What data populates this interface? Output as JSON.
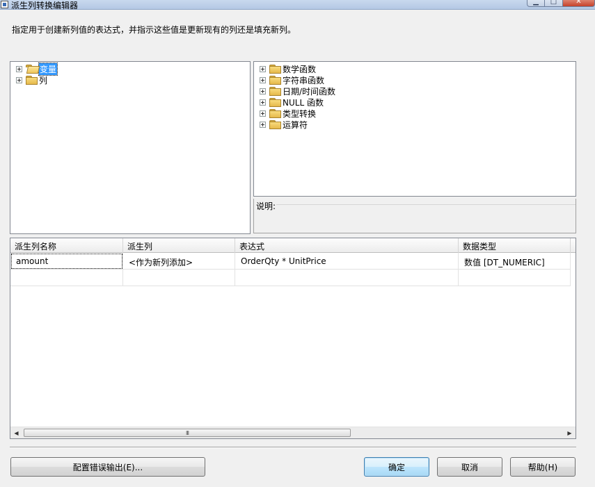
{
  "window": {
    "title": "派生列转换编辑器"
  },
  "instruction": "指定用于创建新列值的表达式，并指示这些值是更新现有的列还是填充新列。",
  "left_tree": {
    "items": [
      {
        "label": "变量",
        "selected": true
      },
      {
        "label": "列",
        "selected": false
      }
    ]
  },
  "right_tree": {
    "items": [
      {
        "label": "数学函数"
      },
      {
        "label": "字符串函数"
      },
      {
        "label": "日期/时间函数"
      },
      {
        "label": "NULL 函数"
      },
      {
        "label": "类型转换"
      },
      {
        "label": "运算符"
      }
    ]
  },
  "description": {
    "label": "说明:"
  },
  "grid": {
    "columns": [
      "派生列名称",
      "派生列",
      "表达式",
      "数据类型"
    ],
    "rows": [
      {
        "name": "amount",
        "derived": "<作为新列添加>",
        "expression": "OrderQty * UnitPrice",
        "type": "数值 [DT_NUMERIC]"
      }
    ],
    "scroll_grip": "III"
  },
  "buttons": {
    "config_error": "配置错误输出(E)...",
    "ok": "确定",
    "cancel": "取消",
    "help": "帮助(H)"
  }
}
